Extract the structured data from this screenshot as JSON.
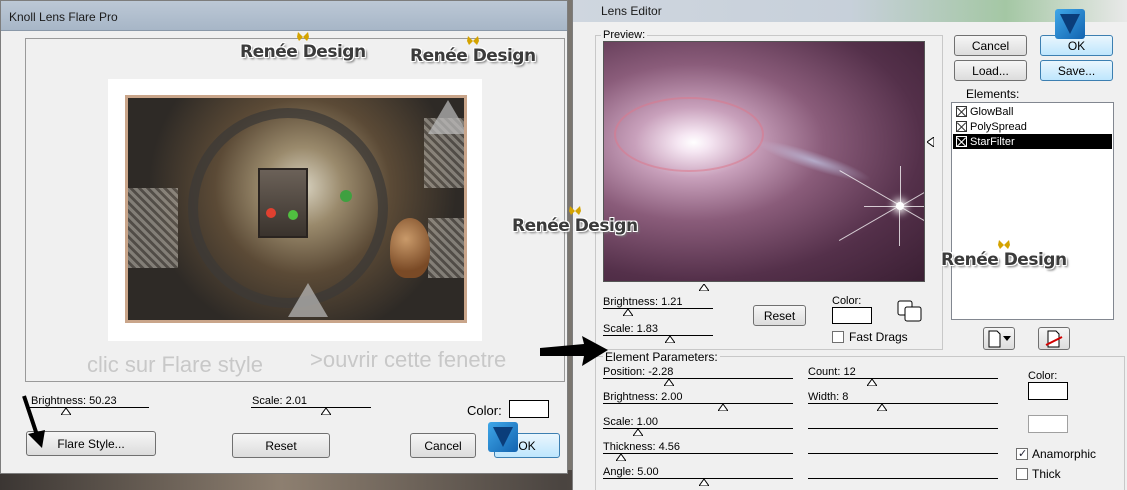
{
  "left_window": {
    "title": "Knoll Lens Flare Pro",
    "brightness_label": "Brightness: 50.23",
    "brightness_value": 50.23,
    "scale_label": "Scale: 2.01",
    "scale_value": 2.01,
    "color_label": "Color:",
    "flare_style_button": "Flare Style...",
    "reset_button": "Reset",
    "cancel_button": "Cancel",
    "ok_button": "OK"
  },
  "annotations": {
    "hint_left": "clic sur Flare style",
    "hint_right": ">ouvrir cette fenetre"
  },
  "watermark": "Renée Design",
  "right_window": {
    "title": "Lens Editor",
    "preview_label": "Preview:",
    "brightness_label": "Brightness: 1.21",
    "brightness_value": 1.21,
    "scale_label": "Scale: 1.83",
    "scale_value": 1.83,
    "color_label": "Color:",
    "reset_button": "Reset",
    "fast_drags_label": "Fast Drags",
    "fast_drags_checked": false,
    "cancel_button": "Cancel",
    "ok_button": "OK",
    "load_button": "Load...",
    "save_button": "Save...",
    "elements_label": "Elements:",
    "elements": [
      {
        "label": "GlowBall",
        "selected": false
      },
      {
        "label": "PolySpread",
        "selected": false
      },
      {
        "label": "StarFilter",
        "selected": true
      }
    ]
  },
  "element_parameters": {
    "title": "Element Parameters:",
    "position_label": "Position:  -2.28",
    "position_value": -2.28,
    "brightness_label": "Brightness:  2.00",
    "brightness_value": 2.0,
    "scale_label": "Scale:  1.00",
    "scale_value": 1.0,
    "thickness_label": "Thickness:  4.56",
    "thickness_value": 4.56,
    "angle_label": "Angle:  5.00",
    "angle_value": 5.0,
    "count_label": "Count:  12",
    "count_value": 12,
    "width_label": "Width:  8",
    "width_value": 8,
    "color_label": "Color:",
    "anamorphic_label": "Anamorphic",
    "anamorphic_checked": true,
    "thick_label": "Thick",
    "thick_checked": false
  },
  "colors": {
    "titlebar": "#a7b6c7",
    "selection": "#000000",
    "flare_core": "#ffffff",
    "flare_outer": "#3a1f33",
    "default_button_border": "#3c7fb1"
  }
}
